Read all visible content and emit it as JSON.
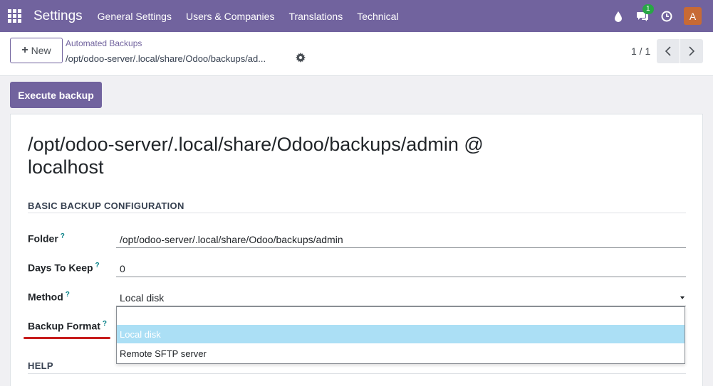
{
  "navbar": {
    "app_title": "Settings",
    "menu": [
      "General Settings",
      "Users & Companies",
      "Translations",
      "Technical"
    ],
    "messages_badge": "1",
    "avatar_initial": "A",
    "color": "#71639e"
  },
  "control_panel": {
    "new_label": "New",
    "breadcrumb_parent": "Automated Backups",
    "breadcrumb_current": "/opt/odoo-server/.local/share/Odoo/backups/ad...",
    "pager": "1 / 1"
  },
  "actions": {
    "execute_label": "Execute backup"
  },
  "form": {
    "title": "/opt/odoo-server/.local/share/Odoo/backups/admin @ localhost",
    "sections": {
      "basic": "BASIC BACKUP CONFIGURATION",
      "help": "HELP"
    },
    "fields": {
      "folder": {
        "label": "Folder",
        "value": "/opt/odoo-server/.local/share/Odoo/backups/admin"
      },
      "days_to_keep": {
        "label": "Days To Keep",
        "value": "0"
      },
      "method": {
        "label": "Method",
        "value": "Local disk"
      },
      "backup_format": {
        "label": "Backup Format"
      }
    },
    "help_marker": "?"
  },
  "dropdown": {
    "options": [
      "",
      "Local disk",
      "Remote SFTP server"
    ],
    "selected_index": 1,
    "highlight_color": "#abdff5"
  }
}
